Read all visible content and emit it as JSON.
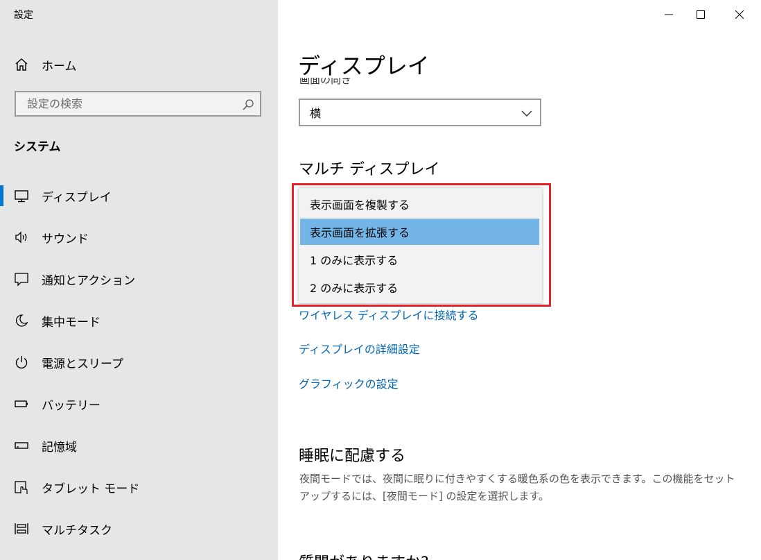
{
  "app": {
    "title": "設定"
  },
  "sidebar": {
    "home_label": "ホーム",
    "search_placeholder": "設定の検索",
    "section_label": "システム",
    "items": [
      {
        "label": "ディスプレイ",
        "icon": "monitor-icon",
        "active": true
      },
      {
        "label": "サウンド",
        "icon": "speaker-icon"
      },
      {
        "label": "通知とアクション",
        "icon": "notification-icon"
      },
      {
        "label": "集中モード",
        "icon": "moon-icon"
      },
      {
        "label": "電源とスリープ",
        "icon": "power-icon"
      },
      {
        "label": "バッテリー",
        "icon": "battery-icon"
      },
      {
        "label": "記憶域",
        "icon": "storage-icon"
      },
      {
        "label": "タブレット モード",
        "icon": "tablet-mode-icon"
      },
      {
        "label": "マルチタスク",
        "icon": "multitask-icon"
      }
    ]
  },
  "window_controls": {
    "minimize": "minimize-icon",
    "maximize": "maximize-icon",
    "close": "close-icon"
  },
  "main": {
    "title": "ディスプレイ",
    "orientation": {
      "label": "画面の向き",
      "value": "横"
    },
    "multi_display": {
      "heading": "マルチ ディスプレイ",
      "options": [
        {
          "label": "表示画面を複製する"
        },
        {
          "label": "表示画面を拡張する",
          "selected": true
        },
        {
          "label": "1 のみに表示する"
        },
        {
          "label": "2 のみに表示する"
        }
      ]
    },
    "links": [
      "ワイヤレス ディスプレイに接続する",
      "ディスプレイの詳細設定",
      "グラフィックの設定"
    ],
    "sleep": {
      "heading": "睡眠に配慮する",
      "description": "夜間モードでは、夜間に眠りに付きやすくする暖色系の色を表示できます。この機能をセットアップするには、[夜間モード] の設定を選択します。"
    },
    "question_heading": "質問がありますか?"
  },
  "colors": {
    "accent": "#0078d4",
    "link": "#0066b4",
    "highlight_border": "#e3212d",
    "selected_option": "#74b5e8"
  }
}
